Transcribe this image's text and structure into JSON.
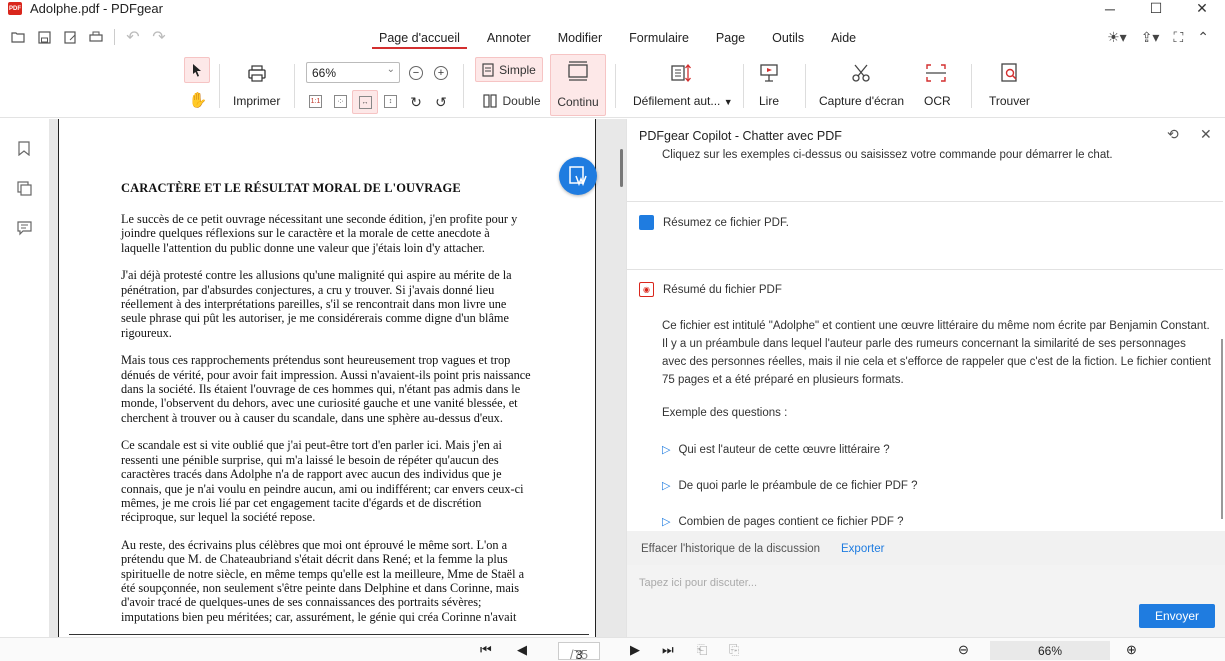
{
  "window": {
    "title": "Adolphe.pdf - PDFgear",
    "logo_text": "PDF"
  },
  "menu": {
    "items": [
      "Page d'accueil",
      "Annoter",
      "Modifier",
      "Formulaire",
      "Page",
      "Outils",
      "Aide"
    ],
    "active": "Page d'accueil"
  },
  "toolbar": {
    "print_label": "Imprimer",
    "zoom_value": "66%",
    "simple_label": "Simple",
    "double_label": "Double",
    "continuous_label": "Continu",
    "autoscroll_label": "Défilement aut...",
    "read_label": "Lire",
    "capture_label": "Capture d'écran",
    "ocr_label": "OCR",
    "find_label": "Trouver"
  },
  "document": {
    "heading": "CARACTÈRE ET LE RÉSULTAT MORAL DE L'OUVRAGE",
    "paragraphs": [
      "Le succès de ce petit ouvrage nécessitant une seconde édition, j'en profite pour y joindre quelques réflexions sur le caractère et la morale de cette anecdote à laquelle l'attention du public donne une valeur que j'étais loin d'y attacher.",
      "J'ai déjà protesté contre les allusions qu'une malignité qui aspire au mérite de la pénétration, par d'absurdes conjectures, a cru y trouver. Si j'avais donné lieu réellement à des interprétations pareilles, s'il se rencontrait dans mon livre une seule phrase qui pût les autoriser, je me considérerais comme digne d'un blâme rigoureux.",
      "Mais tous ces rapprochements prétendus sont heureusement trop vagues et trop dénués de vérité, pour avoir fait impression. Aussi n'avaient-ils point pris naissance dans la société. Ils étaient l'ouvrage de ces hommes qui, n'étant pas admis dans le monde, l'observent du dehors, avec une curiosité gauche et une vanité blessée, et cherchent à trouver ou à causer du scandale, dans une sphère au-dessus d'eux.",
      "Ce scandale est si vite oublié que j'ai peut-être tort d'en parler ici. Mais j'en ai ressenti une pénible surprise, qui m'a laissé le besoin de répéter qu'aucun des caractères tracés dans Adolphe n'a de rapport avec aucun des individus que je connais, que je n'ai voulu en peindre aucun, ami ou indifférent; car envers ceux-ci mêmes, je me crois lié par cet engagement tacite d'égards et de discrétion réciproque, sur lequel la société repose.",
      "Au reste, des écrivains plus célèbres que moi ont éprouvé le même sort. L'on a prétendu que M. de Chateaubriand s'était décrit dans René; et la femme la plus spirituelle de notre siècle, en même temps qu'elle est la meilleure, Mme de Staël a été soupçonnée, non seulement s'être peinte dans Delphine et dans Corinne, mais d'avoir tracé de quelques-unes de ses connaissances des portraits sévères; imputations bien peu méritées; car, assurément, le génie qui créa Corinne n'avait"
    ]
  },
  "navigation": {
    "current_page": "3",
    "total_pages": "/75",
    "zoom": "66%"
  },
  "copilot": {
    "title": "PDFgear Copilot - Chatter avec PDF",
    "hint": "Cliquez sur les exemples ci-dessus ou saisissez votre commande pour démarrer le chat.",
    "user_message": "Résumez ce fichier PDF.",
    "bot_title": "Résumé du fichier PDF",
    "summary": "Ce fichier est intitulé \"Adolphe\" et contient une œuvre littéraire du même nom écrite par Benjamin Constant. Il y a un préambule dans lequel l'auteur parle des rumeurs concernant la similarité de ses personnages avec des personnes réelles, mais il nie cela et s'efforce de rappeler que c'est de la fiction. Le fichier contient 75 pages et a été préparé en plusieurs formats.",
    "examples_label": "Exemple des questions :",
    "questions": [
      "Qui est l'auteur de cette œuvre littéraire ?",
      "De quoi parle le préambule de ce fichier PDF ?",
      "Combien de pages contient ce fichier PDF ?"
    ],
    "clear_history": "Effacer l'historique de la discussion",
    "export": "Exporter",
    "input_placeholder": "Tapez ici pour discuter...",
    "send_label": "Envoyer"
  },
  "colors": {
    "accent": "#1f7ce0",
    "active_underline": "#d32f2f",
    "selected_bg": "#fde8e8"
  }
}
